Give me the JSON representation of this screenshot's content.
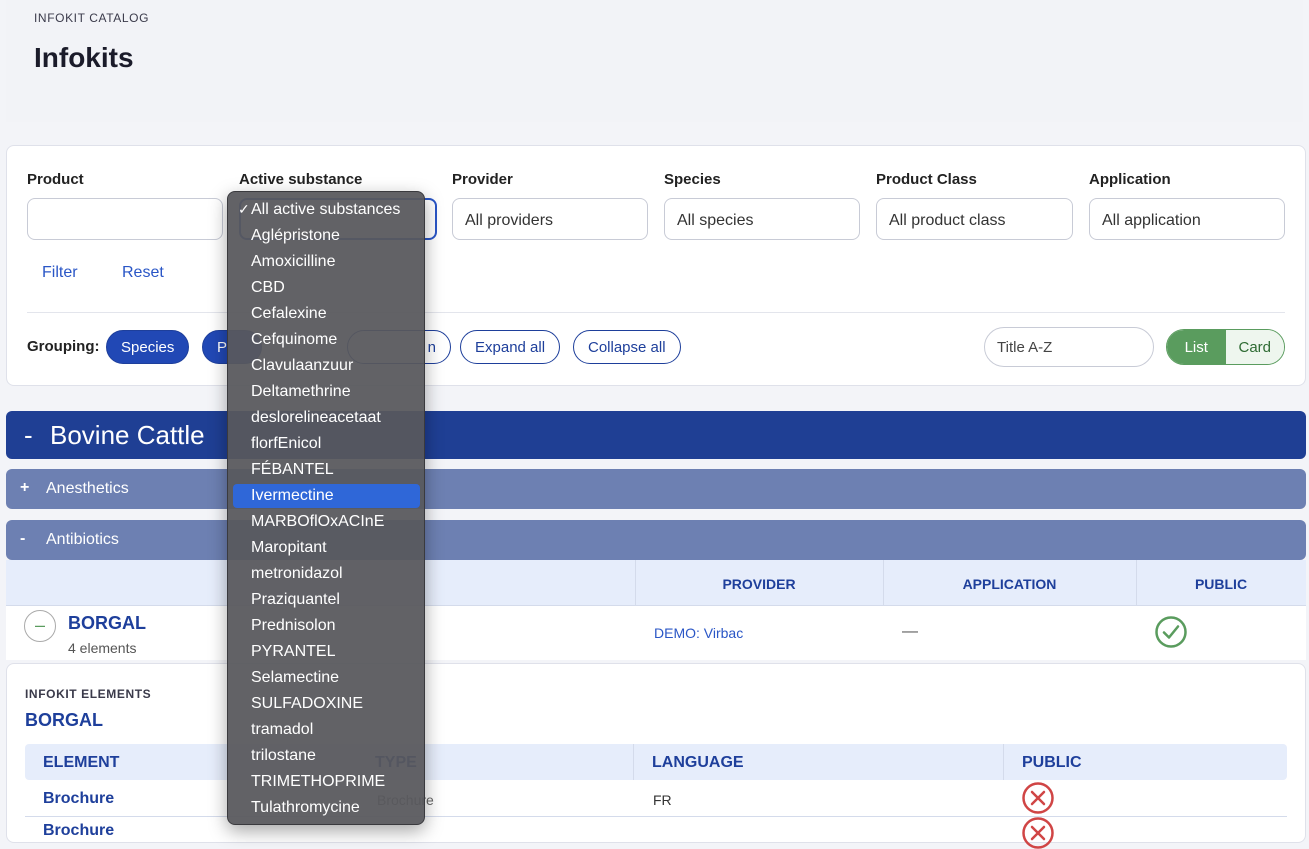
{
  "header": {
    "breadcrumb": "INFOKIT CATALOG",
    "title": "Infokits"
  },
  "filters": {
    "product": {
      "label": "Product",
      "value": ""
    },
    "active_substance": {
      "label": "Active substance"
    },
    "provider": {
      "label": "Provider",
      "value": "All providers"
    },
    "species": {
      "label": "Species",
      "value": "All species"
    },
    "product_class": {
      "label": "Product Class",
      "value": "All product class"
    },
    "application": {
      "label": "Application",
      "value": "All application"
    },
    "filter_label": "Filter",
    "reset_label": "Reset"
  },
  "grouping": {
    "label": "Grouping:",
    "species": "Species",
    "product_class_partial": "P",
    "application_partial": "n",
    "expand_all": "Expand all",
    "collapse_all": "Collapse all"
  },
  "sort": {
    "value": "Title A-Z"
  },
  "view_toggle": {
    "list": "List",
    "card": "Card"
  },
  "groups": {
    "bovine": {
      "sign": "-",
      "title": "Bovine Cattle"
    },
    "anesthetics": {
      "sign": "+",
      "title": "Anesthetics"
    },
    "antibiotics": {
      "sign": "-",
      "title": "Antibiotics"
    }
  },
  "table": {
    "columns": {
      "provider": "PROVIDER",
      "application": "APPLICATION",
      "public": "PUBLIC"
    },
    "row": {
      "title": "BORGAL",
      "subtitle": "4 elements",
      "provider": "DEMO: Virbac",
      "application": "—",
      "public": true,
      "expand_sign": "–"
    }
  },
  "detail": {
    "eyebrow": "INFOKIT ELEMENTS",
    "title": "BORGAL",
    "columns": {
      "element": "ELEMENT",
      "type": "TYPE",
      "language": "LANGUAGE",
      "public": "PUBLIC"
    },
    "rows": [
      {
        "element": "Brochure",
        "type": "Brochure",
        "language": "FR",
        "public": false
      },
      {
        "element": "Brochure",
        "type": "",
        "language": "",
        "public": false
      }
    ]
  },
  "dropdown": {
    "selected": "All active substances",
    "highlighted": "Ivermectine",
    "options": [
      "All active substances",
      "Aglépristone",
      "Amoxicilline",
      "CBD",
      "Cefalexine",
      "Cefquinome",
      "Clavulaanzuur",
      "Deltamethrine",
      "deslorelineacetaat",
      "florfEnicol",
      "FÉBANTEL",
      "Ivermectine",
      "MARBOflOxACInE",
      "Maropitant",
      "metronidazol",
      "Praziquantel",
      "Prednisolon",
      "PYRANTEL",
      "Selamectine",
      "SULFADOXINE",
      "tramadol",
      "trilostane",
      "TRIMETHOPRIME",
      "Tulathromycine"
    ],
    "tick": "✓"
  },
  "colors": {
    "primary": "#1f3f94",
    "accent": "#2a56c6",
    "success": "#5a9c5e",
    "danger": "#d04545"
  }
}
